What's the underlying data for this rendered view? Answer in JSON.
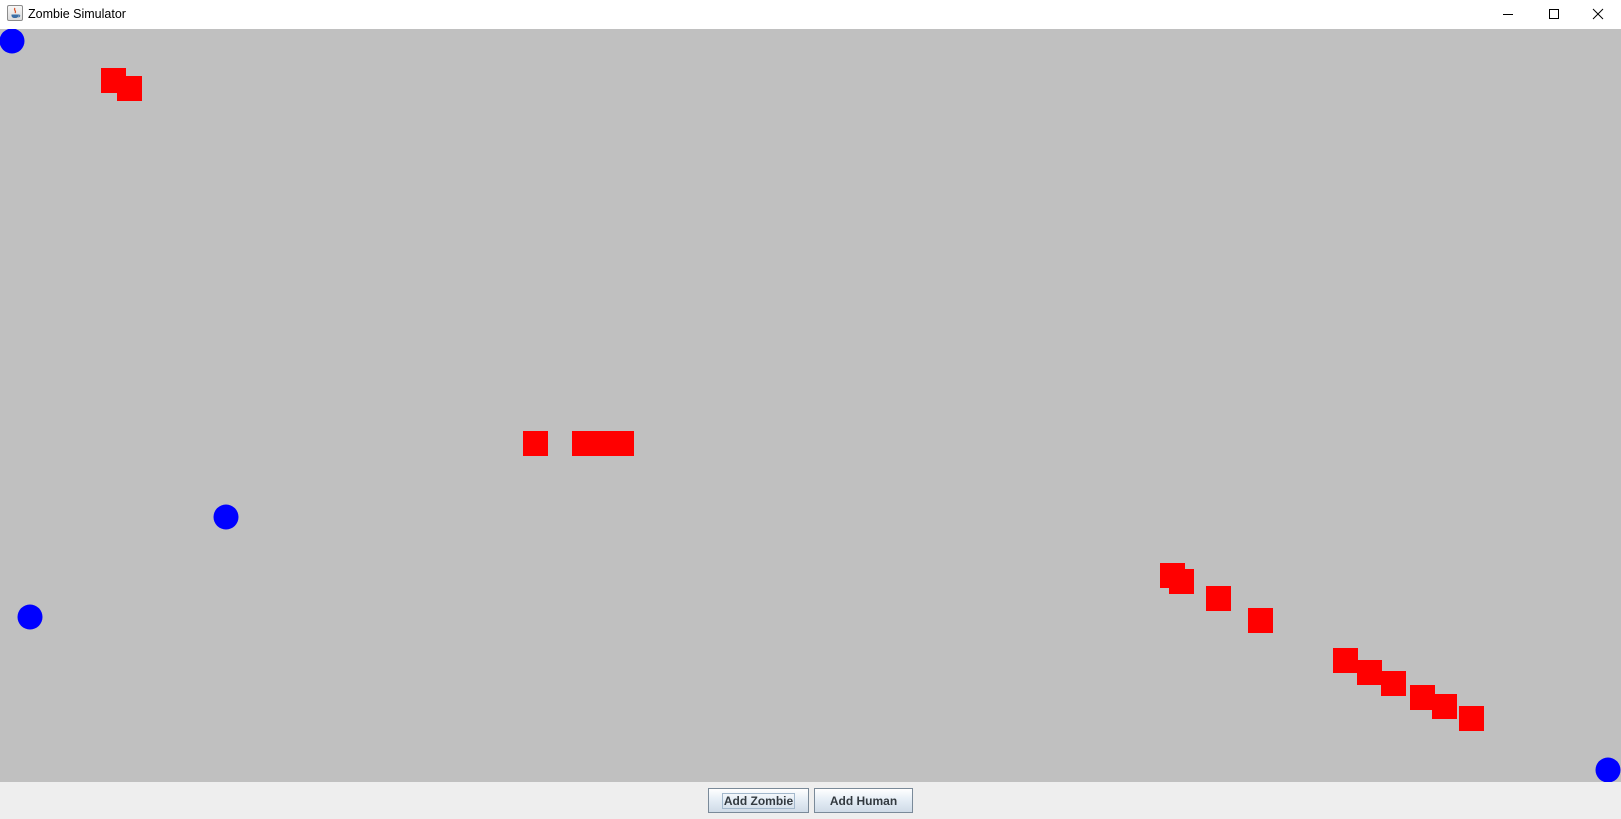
{
  "window": {
    "title": "Zombie Simulator",
    "controls": [
      "minimize-icon",
      "maximize-icon",
      "close-icon"
    ]
  },
  "colors": {
    "canvas_background": "#c0c0c0",
    "zombie": "#ff0000",
    "human": "#0000ff",
    "bottom_bar": "#eeeeee"
  },
  "toolbar": {
    "add_zombie_label": "Add Zombie",
    "add_human_label": "Add Human"
  }
}
